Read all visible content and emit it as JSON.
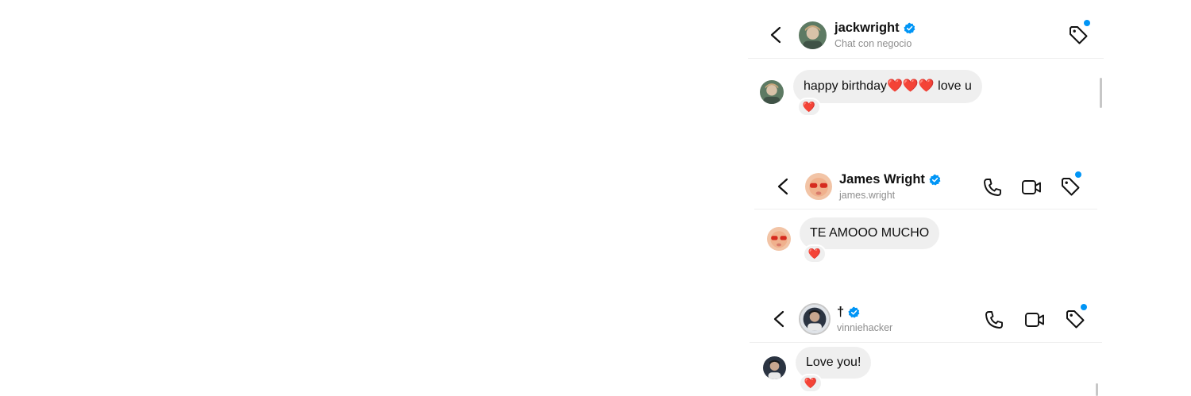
{
  "accent_color": "#0095f6",
  "bubble_color": "#efefef",
  "heart_glyph": "❤️",
  "chats": [
    {
      "name": "jackwright",
      "subtitle": "Chat con negocio",
      "verified": true,
      "message_pre": "happy birthday",
      "message_hearts": "❤️❤️❤️",
      "message_post": " love u",
      "reaction": "❤️",
      "actions": [
        "tag-icon"
      ]
    },
    {
      "name": "James Wright",
      "subtitle": "james.wright",
      "verified": true,
      "message": "TE AMOOO MUCHO",
      "reaction": "❤️",
      "actions": [
        "phone-icon",
        "video-icon",
        "tag-icon"
      ]
    },
    {
      "name": "†",
      "subtitle": "vinniehacker",
      "verified": true,
      "message": "Love you!",
      "reaction": "❤️",
      "actions": [
        "phone-icon",
        "video-icon",
        "tag-icon"
      ]
    }
  ]
}
